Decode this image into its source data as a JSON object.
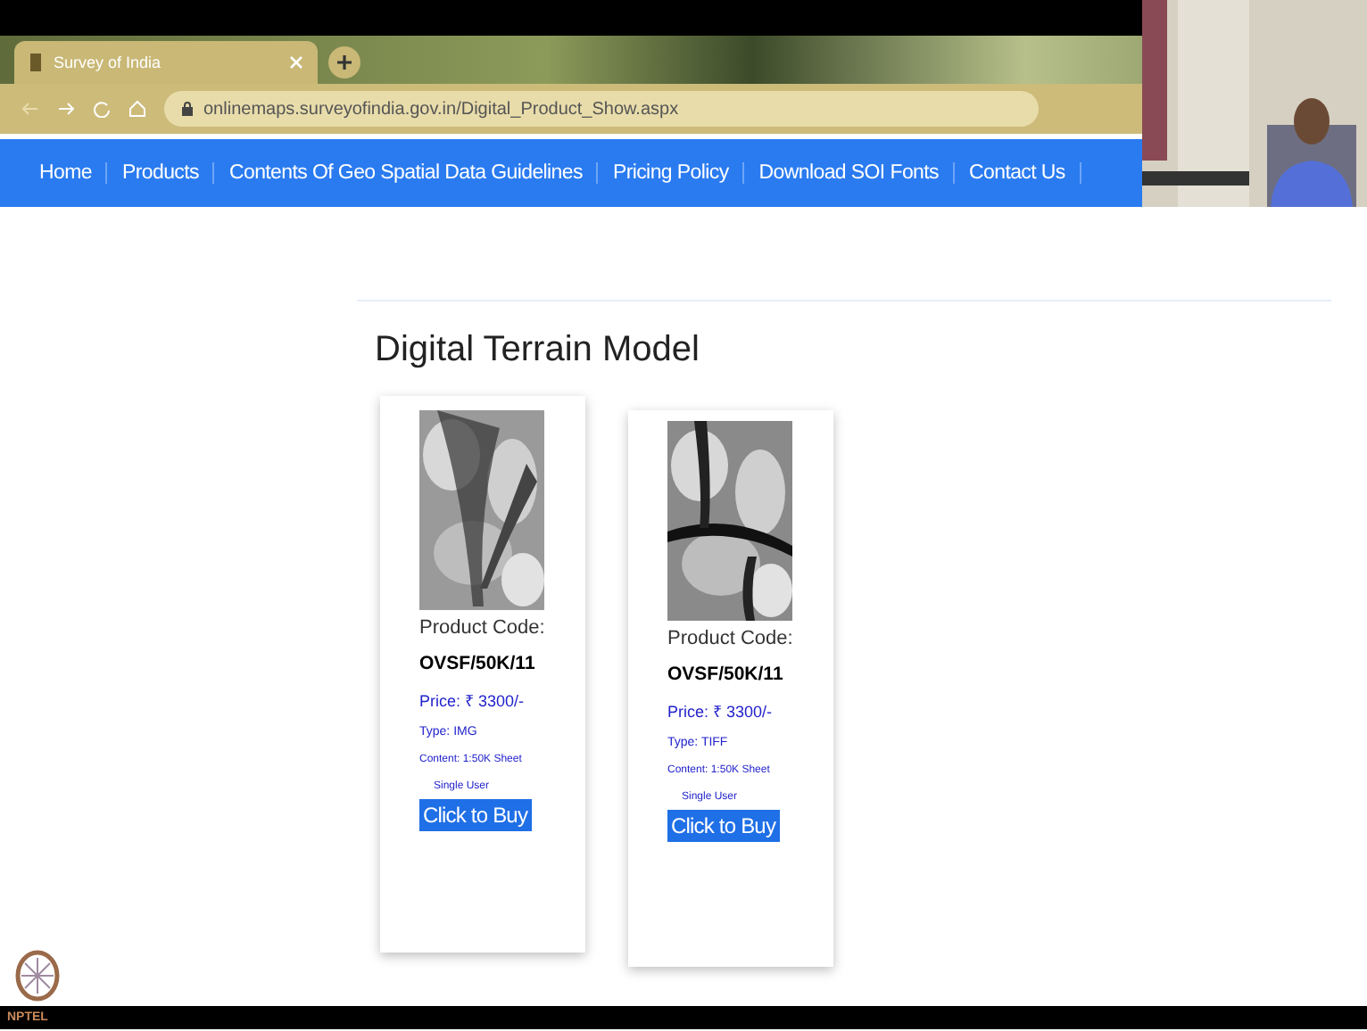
{
  "browser": {
    "tab_title": "Survey of India",
    "url": "onlinemaps.surveyofindia.gov.in/Digital_Product_Show.aspx"
  },
  "nav": {
    "items": [
      "Home",
      "Products",
      "Contents Of Geo Spatial Data Guidelines",
      "Pricing Policy",
      "Download SOI Fonts",
      "Contact Us"
    ]
  },
  "heading": "Digital Terrain Model",
  "products": [
    {
      "code_label": "Product Code:",
      "code": "OVSF/50K/11",
      "price": "Price: ₹ 3300/-",
      "type": "Type: IMG",
      "content": "Content: 1:50K Sheet",
      "license": "Single User",
      "button": "Click to Buy"
    },
    {
      "code_label": "Product Code:",
      "code": "OVSF/50K/11",
      "price": "Price: ₹ 3300/-",
      "type": "Type: TIFF",
      "content": "Content: 1:50K Sheet",
      "license": "Single User",
      "button": "Click to Buy"
    }
  ],
  "footer": {
    "logo_text": "NPTEL"
  }
}
